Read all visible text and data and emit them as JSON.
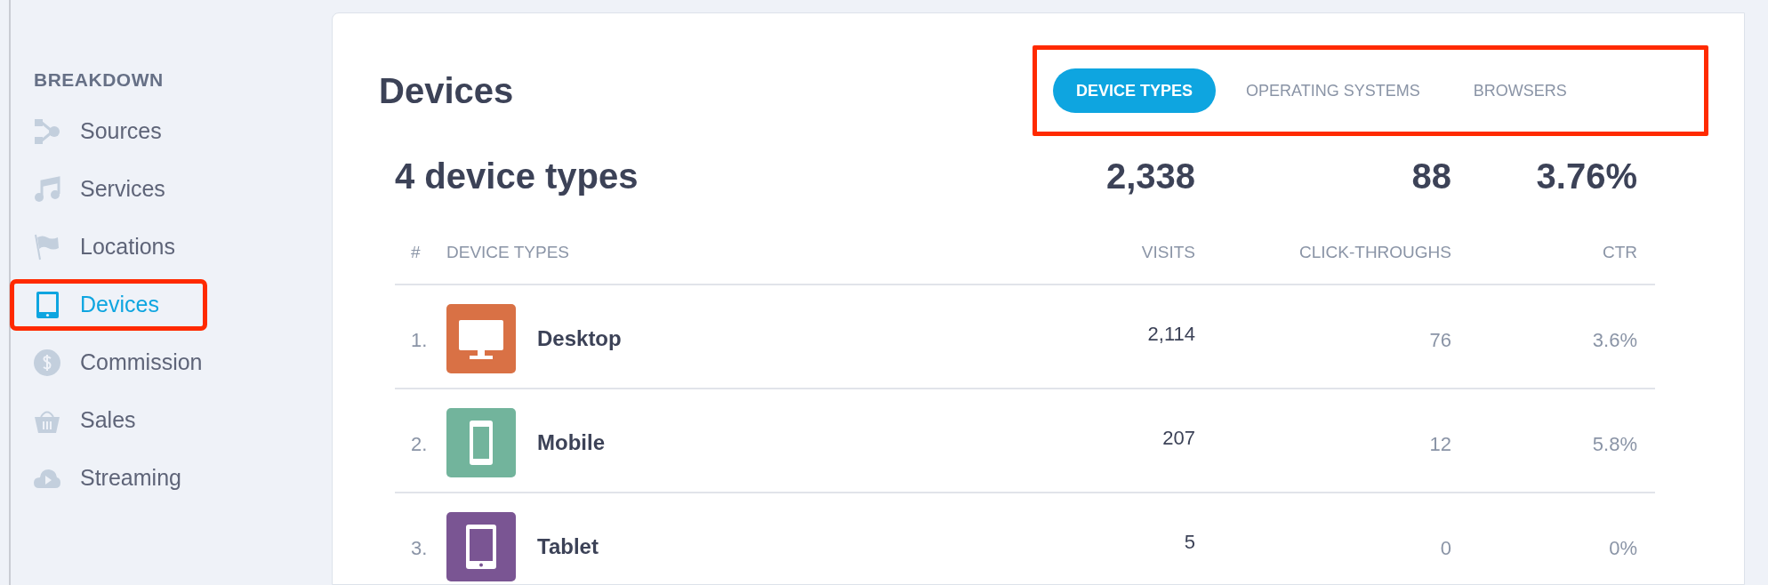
{
  "sidebar": {
    "heading": "BREAKDOWN",
    "items": [
      {
        "label": "Sources",
        "selected": false,
        "highlighted": false
      },
      {
        "label": "Services",
        "selected": false,
        "highlighted": false
      },
      {
        "label": "Locations",
        "selected": false,
        "highlighted": false
      },
      {
        "label": "Devices",
        "selected": true,
        "highlighted": true
      },
      {
        "label": "Commission",
        "selected": false,
        "highlighted": false
      },
      {
        "label": "Sales",
        "selected": false,
        "highlighted": false
      },
      {
        "label": "Streaming",
        "selected": false,
        "highlighted": false
      }
    ]
  },
  "panel": {
    "title": "Devices",
    "tabs_highlighted": true,
    "tabs": [
      {
        "label": "DEVICE TYPES",
        "selected": true
      },
      {
        "label": "OPERATING SYSTEMS",
        "selected": false
      },
      {
        "label": "BROWSERS",
        "selected": false
      }
    ],
    "summary": {
      "count": "4 device types",
      "visits": "2,338",
      "click_throughs": "88",
      "ctr": "3.76%"
    },
    "table": {
      "columns": [
        "#",
        "DEVICE TYPES",
        "VISITS",
        "CLICK-THROUGHS",
        "CTR"
      ],
      "rows": [
        {
          "rank": "1.",
          "kind": "desktop",
          "color": "#d97145",
          "name": "Desktop",
          "visits": "2,114",
          "click_throughs": "76",
          "ctr": "3.6%"
        },
        {
          "rank": "2.",
          "kind": "mobile",
          "color": "#72b49c",
          "name": "Mobile",
          "visits": "207",
          "click_throughs": "12",
          "ctr": "5.8%"
        },
        {
          "rank": "3.",
          "kind": "tablet",
          "color": "#7a5593",
          "name": "Tablet",
          "visits": "5",
          "click_throughs": "0",
          "ctr": "0%"
        }
      ]
    }
  }
}
